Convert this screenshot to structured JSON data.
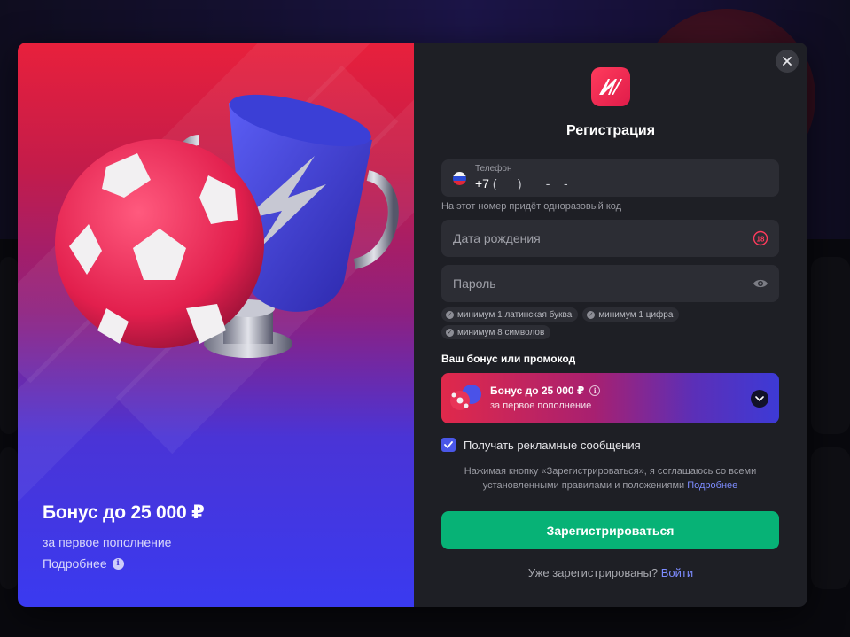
{
  "colors": {
    "accent_green": "#07b276",
    "link_blue": "#7d8cff",
    "form_bg": "#1e1f25",
    "field_bg": "#2c2d34",
    "brand_red": "#e8203c",
    "brand_blue": "#3a3af0"
  },
  "promo": {
    "title": "Бонус до 25 000 ₽",
    "subtitle": "за первое пополнение",
    "more_link": "Подробнее",
    "info_icon": "info-icon"
  },
  "form": {
    "title": "Регистрация",
    "close_icon": "close-icon",
    "phone": {
      "label": "Телефон",
      "country_code": "+7",
      "mask": " (___) ___-__-__",
      "hint": "На этот номер придёт одноразовый код",
      "flag_icon": "russia-flag-icon"
    },
    "birthdate": {
      "placeholder": "Дата рождения",
      "age_icon": "18-plus-icon"
    },
    "password": {
      "placeholder": "Пароль",
      "visibility_icon": "eye-icon",
      "requirements": [
        "минимум 1 латинская буква",
        "минимум 1 цифра",
        "минимум 8 символов"
      ]
    },
    "bonus": {
      "section_label": "Ваш бонус или промокод",
      "title": "Бонус до 25 000 ₽",
      "subtitle": "за первое пополнение"
    },
    "marketing_checkbox": {
      "label": "Получать рекламные сообщения",
      "checked": true
    },
    "terms": {
      "text": "Нажимая кнопку «Зарегистрироваться», я соглашаюсь со всеми установленными правилами и положениями",
      "link": "Подробнее"
    },
    "submit_label": "Зарегистрироваться",
    "login_prompt": "Уже зарегистрированы?",
    "login_link": "Войти"
  }
}
